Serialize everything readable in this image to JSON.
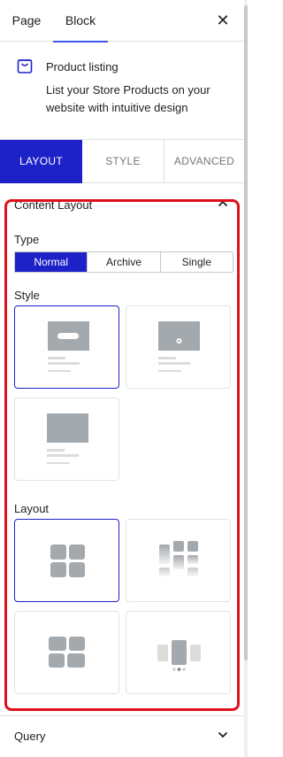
{
  "top_tabs": {
    "page": "Page",
    "block": "Block"
  },
  "icons": {
    "close": "close-icon",
    "block": "store-bag-icon"
  },
  "close_symbol": "✕",
  "block": {
    "title": "Product listing",
    "description": "List your Store Products on your website with intuitive design"
  },
  "settings_tabs": {
    "layout": "LAYOUT",
    "style": "STYLE",
    "advanced": "ADVANCED"
  },
  "content_layout": {
    "title": "Content Layout",
    "type_label": "Type",
    "type_options": [
      "Normal",
      "Archive",
      "Single"
    ],
    "type_selected": "Normal",
    "style_label": "Style",
    "layout_label": "Layout"
  },
  "query": {
    "title": "Query"
  },
  "colors": {
    "accent": "#1d22c8",
    "highlight_frame": "#e0101c",
    "placeholder_gray": "#a4a9ae"
  }
}
